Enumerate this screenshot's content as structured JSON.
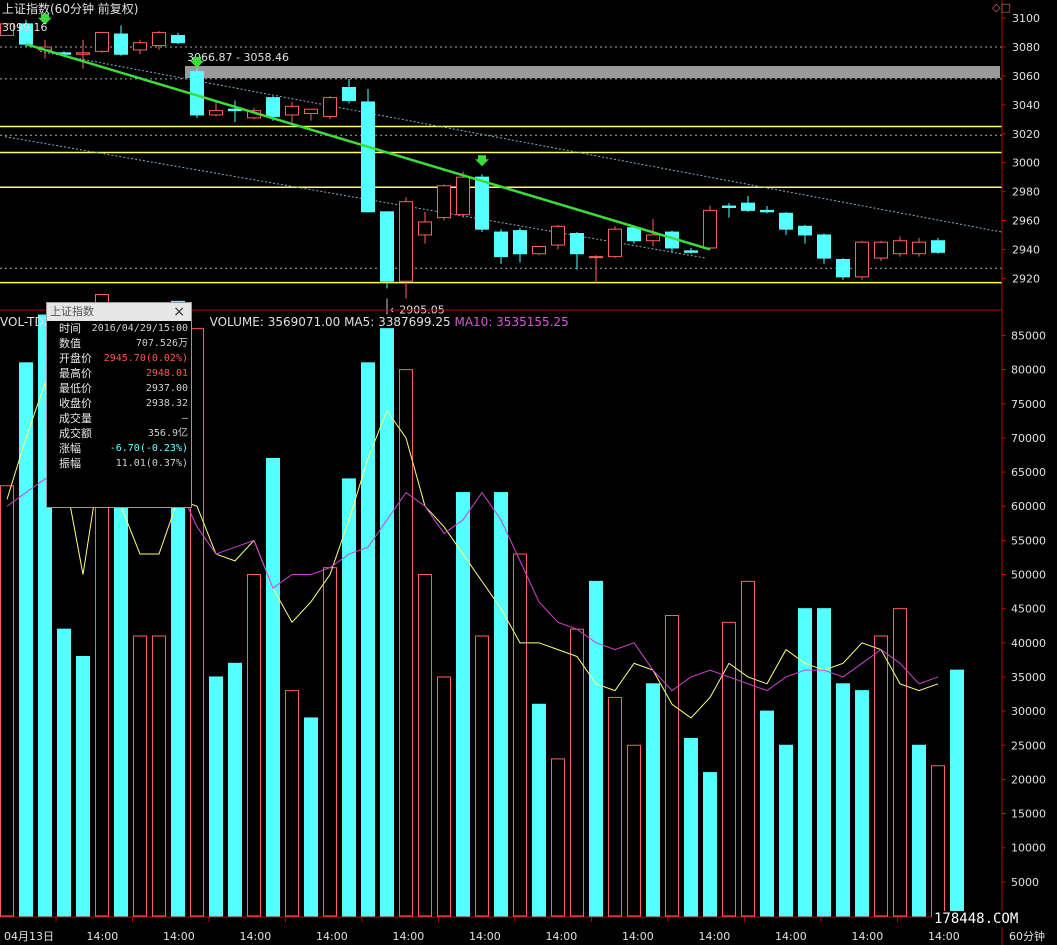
{
  "header": {
    "title": "上证指数(60分钟 前复权)",
    "corner_icons": "◇□",
    "topleft_price": "3099.16"
  },
  "annotations": {
    "range_label": "3066.87 - 3058.46",
    "low_label": "2905.05"
  },
  "volume_header": {
    "indicator": "VOL-TDX",
    "volume": "VOLUME: 3569071.00",
    "ma5": "MA5: 3387699.25",
    "ma10": "MA10: 3535155.25"
  },
  "info_panel": {
    "title": "上证指数",
    "close_icon": "×",
    "rows": [
      {
        "k": "时间",
        "v": "2016/04/29/15:00",
        "c": ""
      },
      {
        "k": "数值",
        "v": "707.526万",
        "c": ""
      },
      {
        "k": "开盘价",
        "v": "2945.70(0.02%)",
        "c": "red"
      },
      {
        "k": "最高价",
        "v": "2948.01",
        "c": "red"
      },
      {
        "k": "最低价",
        "v": "2937.00",
        "c": ""
      },
      {
        "k": "收盘价",
        "v": "2938.32",
        "c": ""
      },
      {
        "k": "成交量",
        "v": "—",
        "c": ""
      },
      {
        "k": "成交额",
        "v": "356.9亿",
        "c": ""
      },
      {
        "k": "涨幅",
        "v": "-6.70(-0.23%)",
        "c": "cyan"
      },
      {
        "k": "振幅",
        "v": "11.01(0.37%)",
        "c": ""
      }
    ]
  },
  "footer": {
    "timeframe": "60分钟",
    "watermark": "178448.COM"
  },
  "colors": {
    "up": "#ff5f5f",
    "down": "#54ffff",
    "trend": "#3cdc3c",
    "support": "#ffff66",
    "ma5": "#ffff80",
    "ma10": "#cc44cc",
    "axis": "#c00000"
  },
  "chart_data": [
    {
      "type": "candlestick",
      "ylim": [
        2905,
        3107
      ],
      "yticks": [
        3100,
        3080,
        3060,
        3040,
        3020,
        3000,
        2980,
        2960,
        2940,
        2920
      ],
      "horizontal_lines": [
        3080,
        3058,
        3025,
        3019,
        3007,
        2983,
        2927,
        2917
      ],
      "highlight_band": [
        3058.46,
        3066.87
      ],
      "candles": [
        {
          "o": 3088,
          "h": 3094,
          "c": 3096
        },
        {
          "o": 3096,
          "h": 3099,
          "l": 3080,
          "c": 3082
        },
        {
          "o": 3078,
          "h": 3085,
          "l": 3072,
          "c": 3080
        },
        {
          "o": 3076,
          "h": 3077,
          "l": 3074,
          "c": 3075
        },
        {
          "o": 3075,
          "h": 3085,
          "l": 3065,
          "c": 3076
        },
        {
          "o": 3077,
          "h": 3090,
          "l": 3076,
          "c": 3090
        },
        {
          "o": 3089,
          "h": 3095,
          "l": 3074,
          "c": 3075
        },
        {
          "o": 3078,
          "h": 3085,
          "l": 3075,
          "c": 3083
        },
        {
          "o": 3081,
          "h": 3091,
          "l": 3078,
          "c": 3090
        },
        {
          "o": 3088,
          "h": 3090,
          "l": 3082,
          "c": 3083
        },
        {
          "o": 3063,
          "h": 3067,
          "l": 3031,
          "c": 3033
        },
        {
          "o": 3033,
          "h": 3042,
          "l": 3032,
          "c": 3036
        },
        {
          "o": 3037,
          "h": 3043,
          "l": 3028,
          "c": 3036
        },
        {
          "o": 3031,
          "h": 3038,
          "l": 3030,
          "c": 3036
        },
        {
          "o": 3045,
          "h": 3046,
          "l": 3029,
          "c": 3032
        },
        {
          "o": 3033,
          "h": 3042,
          "l": 3028,
          "c": 3039
        },
        {
          "o": 3034,
          "h": 3037,
          "l": 3029,
          "c": 3037
        },
        {
          "o": 3032,
          "h": 3046,
          "l": 3030,
          "c": 3045
        },
        {
          "o": 3052,
          "h": 3058,
          "l": 3041,
          "c": 3043
        },
        {
          "o": 3042,
          "h": 3051,
          "l": 2966,
          "c": 2966
        },
        {
          "o": 2966,
          "h": 2966,
          "l": 2913,
          "c": 2918
        },
        {
          "o": 2918,
          "h": 2976,
          "l": 2906,
          "c": 2973
        },
        {
          "o": 2950,
          "h": 2966,
          "l": 2944,
          "c": 2959
        },
        {
          "o": 2962,
          "h": 2985,
          "l": 2960,
          "c": 2984
        },
        {
          "o": 2964,
          "h": 2994,
          "l": 2962,
          "c": 2990
        },
        {
          "o": 2990,
          "h": 2992,
          "l": 2952,
          "c": 2954
        },
        {
          "o": 2952,
          "h": 2954,
          "l": 2930,
          "c": 2935
        },
        {
          "o": 2953,
          "h": 2955,
          "l": 2931,
          "c": 2937
        },
        {
          "o": 2937,
          "h": 2942,
          "l": 2936,
          "c": 2942
        },
        {
          "o": 2943,
          "h": 2957,
          "l": 2940,
          "c": 2956
        },
        {
          "o": 2951,
          "h": 2952,
          "l": 2926,
          "c": 2937
        },
        {
          "o": 2935,
          "h": 2936,
          "l": 2917,
          "c": 2935
        },
        {
          "o": 2935,
          "h": 2956,
          "l": 2934,
          "c": 2954
        },
        {
          "o": 2955,
          "h": 2955,
          "l": 2944,
          "c": 2946
        },
        {
          "o": 2946,
          "h": 2961,
          "l": 2942,
          "c": 2950
        },
        {
          "o": 2952,
          "h": 2953,
          "l": 2938,
          "c": 2941
        },
        {
          "o": 2939,
          "h": 2941,
          "l": 2937,
          "c": 2938
        },
        {
          "o": 2941,
          "h": 2970,
          "l": 2940,
          "c": 2967
        },
        {
          "o": 2970,
          "h": 2972,
          "l": 2962,
          "c": 2969
        },
        {
          "o": 2972,
          "h": 2977,
          "l": 2966,
          "c": 2967
        },
        {
          "o": 2967,
          "h": 2970,
          "l": 2965,
          "c": 2966
        },
        {
          "o": 2965,
          "h": 2966,
          "l": 2950,
          "c": 2954
        },
        {
          "o": 2956,
          "h": 2957,
          "l": 2944,
          "c": 2950
        },
        {
          "o": 2950,
          "h": 2951,
          "l": 2930,
          "c": 2934
        },
        {
          "o": 2933,
          "h": 2934,
          "l": 2919,
          "c": 2921
        },
        {
          "o": 2921,
          "h": 2946,
          "l": 2919,
          "c": 2945
        },
        {
          "o": 2934,
          "h": 2946,
          "l": 2932,
          "c": 2945
        },
        {
          "o": 2937,
          "h": 2949,
          "l": 2935,
          "c": 2946
        },
        {
          "o": 2937,
          "h": 2948,
          "l": 2935,
          "c": 2945
        },
        {
          "o": 2946,
          "h": 2948,
          "l": 2937,
          "c": 2938
        }
      ],
      "trendline": {
        "from": [
          1,
          3082
        ],
        "to": [
          37,
          2940
        ]
      }
    },
    {
      "type": "bar",
      "ylim": [
        0,
        88000
      ],
      "yticks": [
        85000,
        80000,
        75000,
        70000,
        65000,
        60000,
        55000,
        50000,
        45000,
        40000,
        35000,
        30000,
        25000,
        20000,
        15000,
        10000,
        5000
      ],
      "x": [
        "04月13日",
        "14:00",
        "14:00",
        "14:00",
        "14:00",
        "14:00",
        "14:00",
        "14:00",
        "14:00",
        "14:00",
        "14:00",
        "14:00",
        "14:00"
      ],
      "volumes": [
        63000,
        81000,
        88000,
        42000,
        38000,
        91000,
        62000,
        41000,
        41000,
        90000,
        86000,
        35000,
        37000,
        50000,
        67000,
        33000,
        29000,
        51000,
        64000,
        81000,
        86000,
        80000,
        50000,
        35000,
        62000,
        41000,
        62000,
        53000,
        31000,
        23000,
        42000,
        49000,
        32000,
        25000,
        34000,
        44000,
        26000,
        21000,
        43000,
        49000,
        30000,
        25000,
        45000,
        45000,
        34000,
        33000,
        41000,
        45000,
        25000,
        22000,
        36000
      ],
      "up": [
        true,
        false,
        false,
        false,
        false,
        true,
        false,
        true,
        true,
        false,
        true,
        false,
        false,
        true,
        false,
        true,
        false,
        true,
        false,
        false,
        false,
        true,
        true,
        true,
        false,
        true,
        false,
        true,
        false,
        true,
        true,
        false,
        true,
        true,
        false,
        true,
        false,
        false,
        true,
        true,
        false,
        false,
        false,
        false,
        false,
        false,
        true,
        true,
        false,
        true,
        false
      ],
      "ma5": [
        61000,
        70000,
        78000,
        65000,
        50000,
        68000,
        60000,
        53000,
        53000,
        61000,
        60000,
        53000,
        52000,
        55000,
        48000,
        43000,
        46000,
        50000,
        58000,
        67000,
        74000,
        70000,
        60000,
        57000,
        53000,
        49000,
        45000,
        40000,
        40000,
        39000,
        38000,
        34000,
        33000,
        37000,
        36000,
        31000,
        29000,
        32000,
        37000,
        35000,
        34000,
        39000,
        37000,
        36000,
        37000,
        40000,
        39000,
        34000,
        33000,
        34000
      ],
      "ma10": [
        60000,
        62000,
        64000,
        66000,
        63000,
        64000,
        62000,
        62000,
        61000,
        63000,
        57000,
        53000,
        54000,
        55000,
        48000,
        50000,
        50000,
        51000,
        53000,
        54000,
        58000,
        62000,
        60000,
        56000,
        58000,
        62000,
        58000,
        52000,
        46000,
        43000,
        42000,
        40000,
        39000,
        40000,
        36000,
        33000,
        35000,
        36000,
        35000,
        34000,
        33000,
        35000,
        36000,
        36000,
        35000,
        37000,
        39000,
        37000,
        34000,
        35000
      ]
    }
  ]
}
